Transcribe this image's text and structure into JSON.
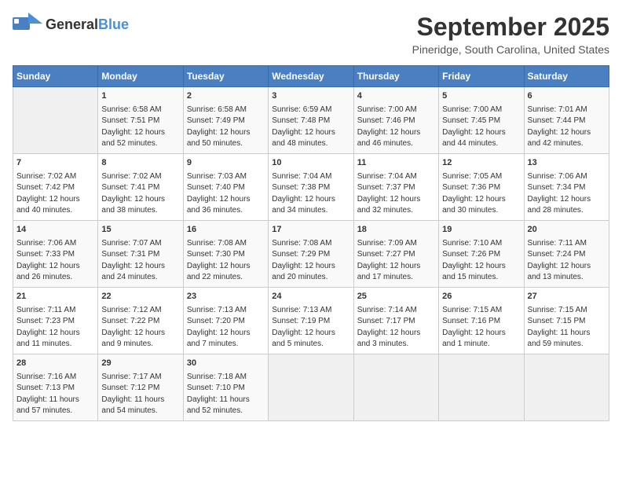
{
  "header": {
    "logo_general": "General",
    "logo_blue": "Blue",
    "title": "September 2025",
    "subtitle": "Pineridge, South Carolina, United States"
  },
  "calendar": {
    "days_of_week": [
      "Sunday",
      "Monday",
      "Tuesday",
      "Wednesday",
      "Thursday",
      "Friday",
      "Saturday"
    ],
    "weeks": [
      [
        {
          "day": "",
          "info": ""
        },
        {
          "day": "1",
          "info": "Sunrise: 6:58 AM\nSunset: 7:51 PM\nDaylight: 12 hours\nand 52 minutes."
        },
        {
          "day": "2",
          "info": "Sunrise: 6:58 AM\nSunset: 7:49 PM\nDaylight: 12 hours\nand 50 minutes."
        },
        {
          "day": "3",
          "info": "Sunrise: 6:59 AM\nSunset: 7:48 PM\nDaylight: 12 hours\nand 48 minutes."
        },
        {
          "day": "4",
          "info": "Sunrise: 7:00 AM\nSunset: 7:46 PM\nDaylight: 12 hours\nand 46 minutes."
        },
        {
          "day": "5",
          "info": "Sunrise: 7:00 AM\nSunset: 7:45 PM\nDaylight: 12 hours\nand 44 minutes."
        },
        {
          "day": "6",
          "info": "Sunrise: 7:01 AM\nSunset: 7:44 PM\nDaylight: 12 hours\nand 42 minutes."
        }
      ],
      [
        {
          "day": "7",
          "info": "Sunrise: 7:02 AM\nSunset: 7:42 PM\nDaylight: 12 hours\nand 40 minutes."
        },
        {
          "day": "8",
          "info": "Sunrise: 7:02 AM\nSunset: 7:41 PM\nDaylight: 12 hours\nand 38 minutes."
        },
        {
          "day": "9",
          "info": "Sunrise: 7:03 AM\nSunset: 7:40 PM\nDaylight: 12 hours\nand 36 minutes."
        },
        {
          "day": "10",
          "info": "Sunrise: 7:04 AM\nSunset: 7:38 PM\nDaylight: 12 hours\nand 34 minutes."
        },
        {
          "day": "11",
          "info": "Sunrise: 7:04 AM\nSunset: 7:37 PM\nDaylight: 12 hours\nand 32 minutes."
        },
        {
          "day": "12",
          "info": "Sunrise: 7:05 AM\nSunset: 7:36 PM\nDaylight: 12 hours\nand 30 minutes."
        },
        {
          "day": "13",
          "info": "Sunrise: 7:06 AM\nSunset: 7:34 PM\nDaylight: 12 hours\nand 28 minutes."
        }
      ],
      [
        {
          "day": "14",
          "info": "Sunrise: 7:06 AM\nSunset: 7:33 PM\nDaylight: 12 hours\nand 26 minutes."
        },
        {
          "day": "15",
          "info": "Sunrise: 7:07 AM\nSunset: 7:31 PM\nDaylight: 12 hours\nand 24 minutes."
        },
        {
          "day": "16",
          "info": "Sunrise: 7:08 AM\nSunset: 7:30 PM\nDaylight: 12 hours\nand 22 minutes."
        },
        {
          "day": "17",
          "info": "Sunrise: 7:08 AM\nSunset: 7:29 PM\nDaylight: 12 hours\nand 20 minutes."
        },
        {
          "day": "18",
          "info": "Sunrise: 7:09 AM\nSunset: 7:27 PM\nDaylight: 12 hours\nand 17 minutes."
        },
        {
          "day": "19",
          "info": "Sunrise: 7:10 AM\nSunset: 7:26 PM\nDaylight: 12 hours\nand 15 minutes."
        },
        {
          "day": "20",
          "info": "Sunrise: 7:11 AM\nSunset: 7:24 PM\nDaylight: 12 hours\nand 13 minutes."
        }
      ],
      [
        {
          "day": "21",
          "info": "Sunrise: 7:11 AM\nSunset: 7:23 PM\nDaylight: 12 hours\nand 11 minutes."
        },
        {
          "day": "22",
          "info": "Sunrise: 7:12 AM\nSunset: 7:22 PM\nDaylight: 12 hours\nand 9 minutes."
        },
        {
          "day": "23",
          "info": "Sunrise: 7:13 AM\nSunset: 7:20 PM\nDaylight: 12 hours\nand 7 minutes."
        },
        {
          "day": "24",
          "info": "Sunrise: 7:13 AM\nSunset: 7:19 PM\nDaylight: 12 hours\nand 5 minutes."
        },
        {
          "day": "25",
          "info": "Sunrise: 7:14 AM\nSunset: 7:17 PM\nDaylight: 12 hours\nand 3 minutes."
        },
        {
          "day": "26",
          "info": "Sunrise: 7:15 AM\nSunset: 7:16 PM\nDaylight: 12 hours\nand 1 minute."
        },
        {
          "day": "27",
          "info": "Sunrise: 7:15 AM\nSunset: 7:15 PM\nDaylight: 11 hours\nand 59 minutes."
        }
      ],
      [
        {
          "day": "28",
          "info": "Sunrise: 7:16 AM\nSunset: 7:13 PM\nDaylight: 11 hours\nand 57 minutes."
        },
        {
          "day": "29",
          "info": "Sunrise: 7:17 AM\nSunset: 7:12 PM\nDaylight: 11 hours\nand 54 minutes."
        },
        {
          "day": "30",
          "info": "Sunrise: 7:18 AM\nSunset: 7:10 PM\nDaylight: 11 hours\nand 52 minutes."
        },
        {
          "day": "",
          "info": ""
        },
        {
          "day": "",
          "info": ""
        },
        {
          "day": "",
          "info": ""
        },
        {
          "day": "",
          "info": ""
        }
      ]
    ]
  }
}
